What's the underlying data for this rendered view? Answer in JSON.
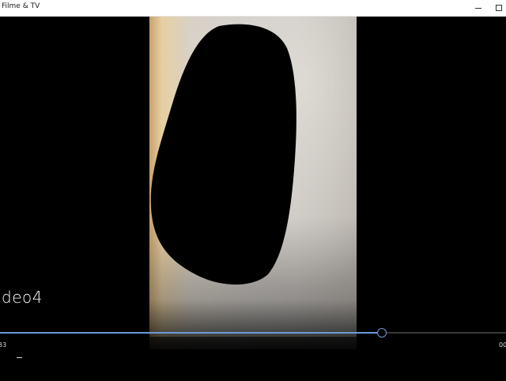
{
  "window": {
    "title": "Filme & TV"
  },
  "player": {
    "video_title": "ideo4",
    "time_elapsed": "33",
    "time_total": "00",
    "progress_fraction": 0.755
  },
  "colors": {
    "accent": "#6b9bd6",
    "background": "#000000",
    "titlebar": "#ffffff"
  },
  "icons": {
    "minimize": "minimize-icon",
    "maximize": "maximize-icon",
    "player_control": "dash-icon"
  }
}
